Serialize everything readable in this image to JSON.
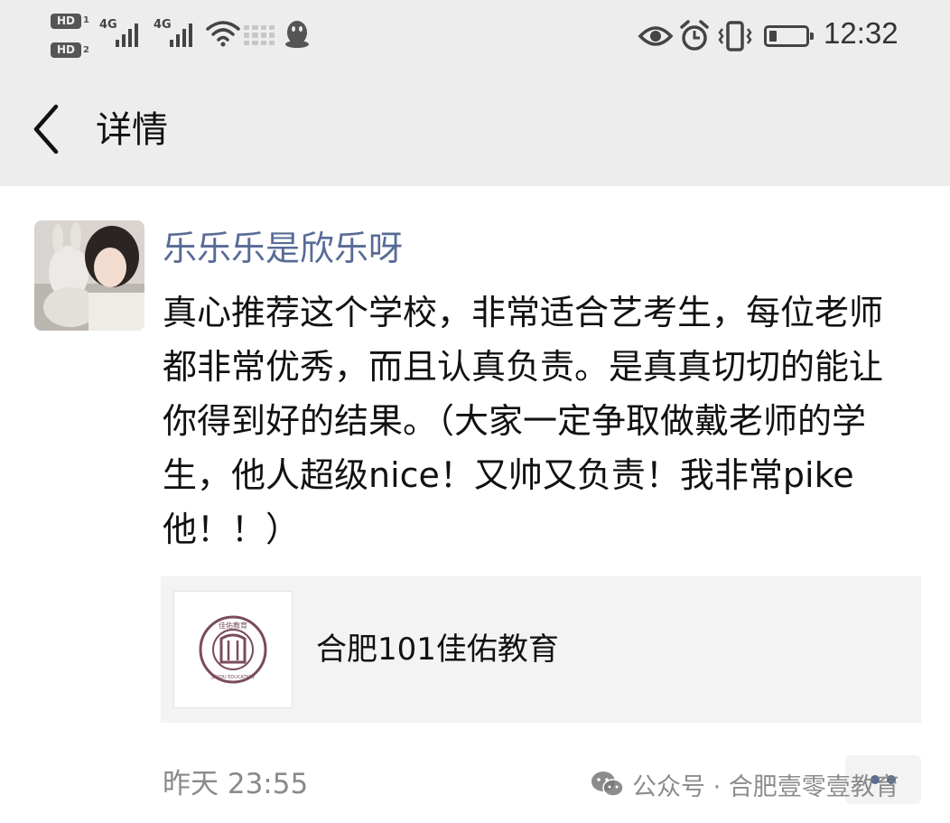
{
  "status_bar": {
    "time": "12:32",
    "hd1": "HD",
    "hd1_sim": "1",
    "hd2": "HD",
    "hd2_sim": "2",
    "net1": "4G",
    "net2": "4G",
    "icons": [
      "hd-icon",
      "signal-icon",
      "wifi-icon",
      "qq-penguin-icon",
      "eye-icon",
      "alarm-icon",
      "vibrate-icon",
      "battery-icon"
    ]
  },
  "nav": {
    "back_icon": "chevron-left-icon",
    "title": "详情"
  },
  "post": {
    "author": "乐乐乐是欣乐呀",
    "avatar": "user-avatar-photo",
    "text": "真心推荐这个学校，非常适合艺考生，每位老师都非常优秀，而且认真负责。是真真切切的能让你得到好的结果。（大家一定争取做戴老师的学生，他人超级nice！又帅又负责！我非常pike他！！）",
    "timestamp": "昨天 23:55"
  },
  "link_card": {
    "title": "合肥101佳佑教育",
    "thumb_icon": "school-logo-seal-icon",
    "logo_text_top": "佳佑教育",
    "logo_text_bottom": "JIAYOU EDUCATION"
  },
  "watermark": {
    "text": "公众号 · 合肥壹零壹教育",
    "icon": "wechat-icon"
  },
  "colors": {
    "top_bg": "#ededed",
    "author_link": "#576b95",
    "card_bg": "#f3f3f3",
    "timestamp": "#8a8a8a"
  }
}
